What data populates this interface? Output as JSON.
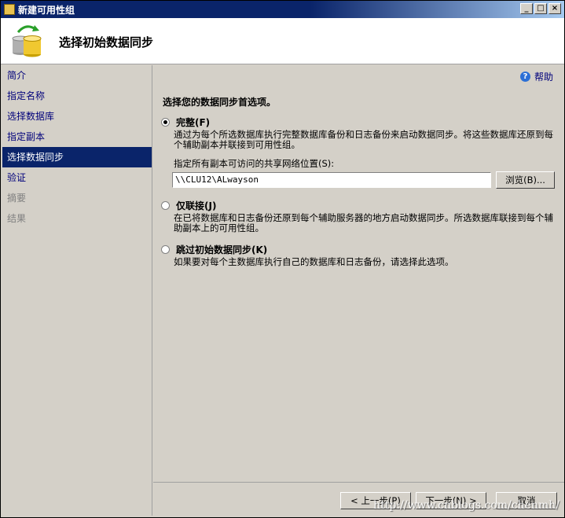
{
  "window": {
    "title": "新建可用性组",
    "minimize": "_",
    "maximize": "□",
    "close": "×"
  },
  "header": {
    "title": "选择初始数据同步"
  },
  "nav": {
    "items": [
      {
        "label": "简介",
        "state": "normal"
      },
      {
        "label": "指定名称",
        "state": "normal"
      },
      {
        "label": "选择数据库",
        "state": "normal"
      },
      {
        "label": "指定副本",
        "state": "normal"
      },
      {
        "label": "选择数据同步",
        "state": "selected"
      },
      {
        "label": "验证",
        "state": "normal"
      },
      {
        "label": "摘要",
        "state": "disabled"
      },
      {
        "label": "结果",
        "state": "disabled"
      }
    ]
  },
  "main": {
    "help": "帮助",
    "heading": "选择您的数据同步首选项。",
    "options": {
      "full": {
        "label": "完整(F)",
        "checked": true,
        "desc": "通过为每个所选数据库执行完整数据库备份和日志备份来启动数据同步。将这些数据库还原到每个辅助副本并联接到可用性组。",
        "share_label": "指定所有副本可访问的共享网络位置(S):",
        "share_value": "\\\\CLU12\\ALwayson",
        "browse": "浏览(B)..."
      },
      "join_only": {
        "label": "仅联接(J)",
        "checked": false,
        "desc": "在已将数据库和日志备份还原到每个辅助服务器的地方启动数据同步。所选数据库联接到每个辅助副本上的可用性组。"
      },
      "skip": {
        "label": "跳过初始数据同步(K)",
        "checked": false,
        "desc": "如果要对每个主数据库执行自己的数据库和日志备份，请选择此选项。"
      }
    }
  },
  "footer": {
    "prev": "< 上一步(P)",
    "next": "下一步(N) >",
    "cancel": "取消",
    "watermark": "http://www.cnblogs.com/chenmh/"
  }
}
